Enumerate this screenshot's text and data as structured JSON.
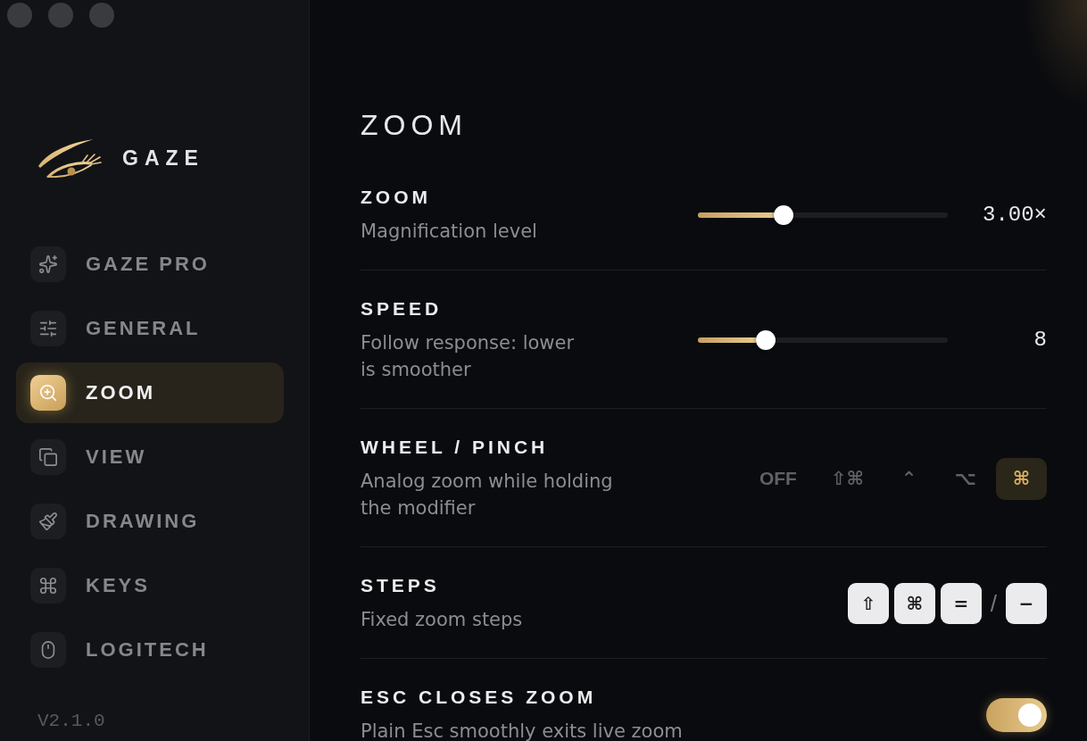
{
  "sidebar": {
    "app_name": "GAZE",
    "items": [
      {
        "label": "GAZE PRO",
        "selected": false
      },
      {
        "label": "GENERAL",
        "selected": false
      },
      {
        "label": "ZOOM",
        "selected": true
      },
      {
        "label": "VIEW",
        "selected": false
      },
      {
        "label": "DRAWING",
        "selected": false
      },
      {
        "label": "KEYS",
        "selected": false
      },
      {
        "label": "LOGITECH",
        "selected": false
      }
    ],
    "version": "V2.1.0"
  },
  "page": {
    "title": "ZOOM"
  },
  "settings": [
    {
      "kind": "slider",
      "label": "ZOOM",
      "description": "Magnification level",
      "level": 0.33,
      "reading": "3.00×"
    },
    {
      "kind": "slider",
      "label": "SPEED",
      "description": "Follow response: lower is smoother",
      "level": 0.25,
      "reading": "8"
    },
    {
      "kind": "choice",
      "label": "WHEEL / PINCH",
      "description": "Analog zoom while holding the modifier",
      "options": [
        {
          "label": "OFF",
          "selected": false
        },
        {
          "label": "⇧⌘",
          "selected": false
        },
        {
          "label": "⌃",
          "selected": false
        },
        {
          "label": "⌥",
          "selected": false
        },
        {
          "label": "⌘",
          "selected": true
        }
      ]
    },
    {
      "kind": "shortcut",
      "label": "STEPS",
      "description": "Fixed zoom steps",
      "keys": [
        {
          "kind": "key",
          "text": "⇧"
        },
        {
          "kind": "key",
          "text": "⌘"
        },
        {
          "kind": "key",
          "text": "="
        },
        {
          "kind": "separator",
          "text": "/"
        },
        {
          "kind": "key",
          "text": "−"
        }
      ]
    },
    {
      "kind": "toggle",
      "label": "ESC CLOSES ZOOM",
      "description": "Plain Esc smoothly exits live zoom",
      "on": true
    }
  ]
}
